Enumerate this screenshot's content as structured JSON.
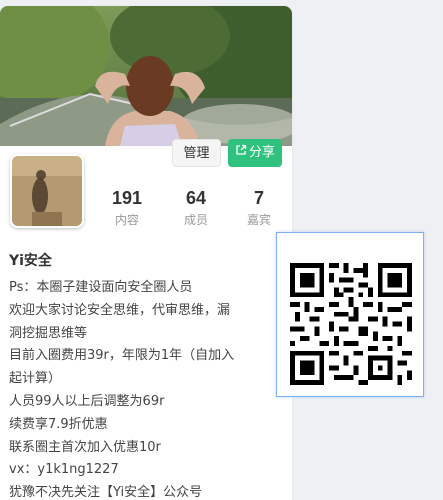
{
  "actions": {
    "manage_label": "管理",
    "share_label": "分享"
  },
  "stats": [
    {
      "value": "191",
      "label": "内容"
    },
    {
      "value": "64",
      "label": "成员"
    },
    {
      "value": "7",
      "label": "嘉宾"
    }
  ],
  "group": {
    "name": "Yi安全",
    "description_lines": [
      "Ps：本圈子建设面向安全圈人员",
      "欢迎大家讨论安全思维，代审思维，漏",
      "洞挖掘思维等",
      "目前入圈费用39r，年限为1年（自加入",
      "起计算）",
      "人员99人以上后调整为69r",
      "续费享7.9折优惠",
      "联系圈主首次加入优惠10r",
      "vx：y1k1ng1227",
      "犹豫不决先关注【Yi安全】公众号"
    ]
  },
  "icons": {
    "share": "share-icon",
    "qr": "qr-code-icon"
  },
  "colors": {
    "share_button": "#2ec27e",
    "qr_border": "#7bb0f2"
  }
}
